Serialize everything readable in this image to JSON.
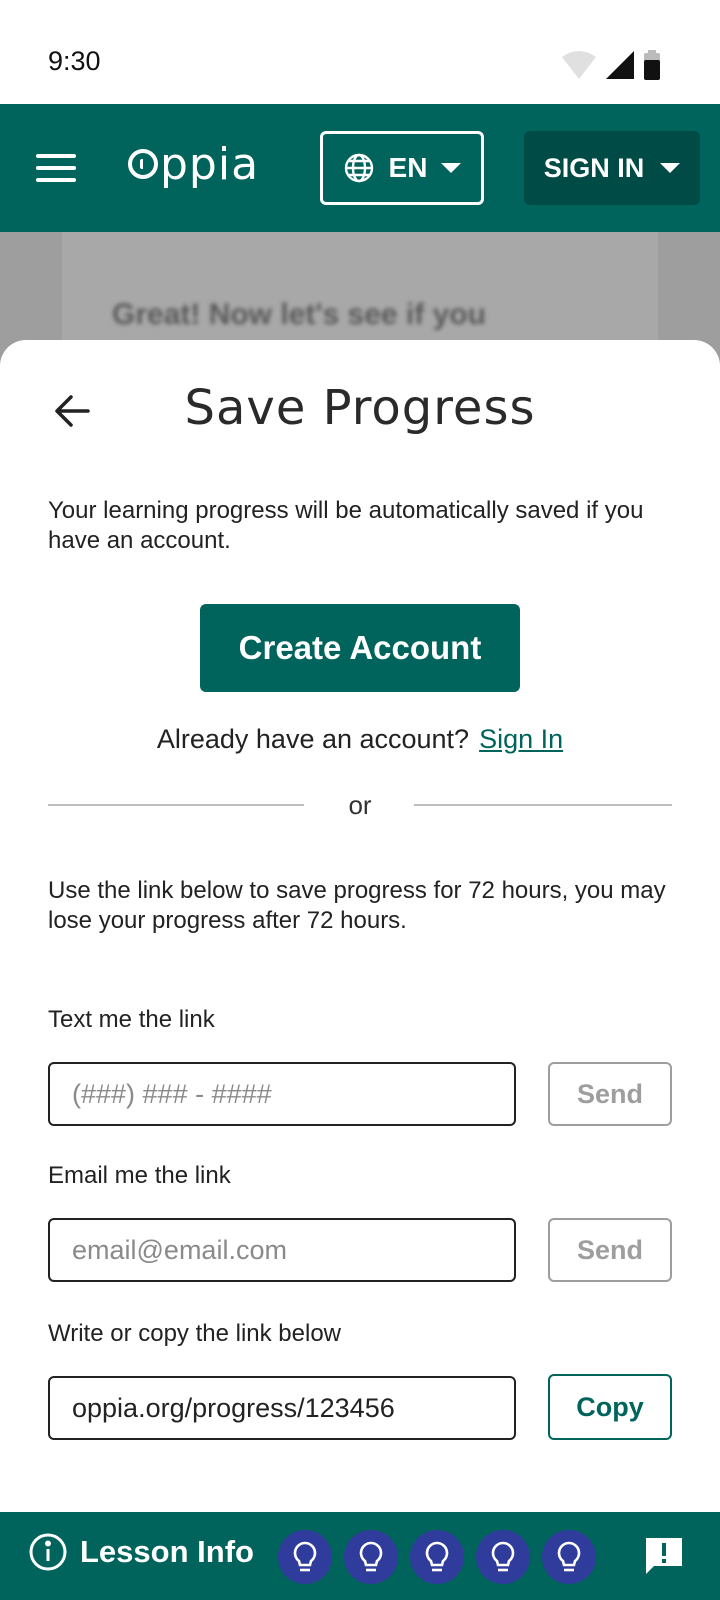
{
  "status_bar": {
    "time": "9:30"
  },
  "header": {
    "logo_text": "ppia",
    "language_label": "EN",
    "sign_in_label": "SIGN IN"
  },
  "background": {
    "card_text": "Great! Now let's see if you"
  },
  "sheet": {
    "title": "Save Progress",
    "intro": "Your learning progress will be automatically saved if you have an account.",
    "create_account_label": "Create Account",
    "already_text": "Already have an account?",
    "sign_in_link": "Sign In",
    "or_text": "or",
    "link_note": "Use the link below to save progress for 72 hours, you may lose your progress after 72 hours.",
    "text_link": {
      "label": "Text me the link",
      "placeholder": "(###) ### - ####",
      "button": "Send"
    },
    "email_link": {
      "label": "Email me the link",
      "placeholder": "email@email.com",
      "button": "Send"
    },
    "copy_link": {
      "label": "Write or copy the link below",
      "value": "oppia.org/progress/123456",
      "button": "Copy"
    }
  },
  "footer": {
    "lesson_info_label": "Lesson Info",
    "hints": [
      "lightbulb-icon",
      "lightbulb-icon",
      "lightbulb-icon",
      "lightbulb-icon",
      "lightbulb-icon"
    ]
  },
  "colors": {
    "brand": "#00645c",
    "brand_dark": "#004b45",
    "hint_bg": "#2f3c9c"
  }
}
